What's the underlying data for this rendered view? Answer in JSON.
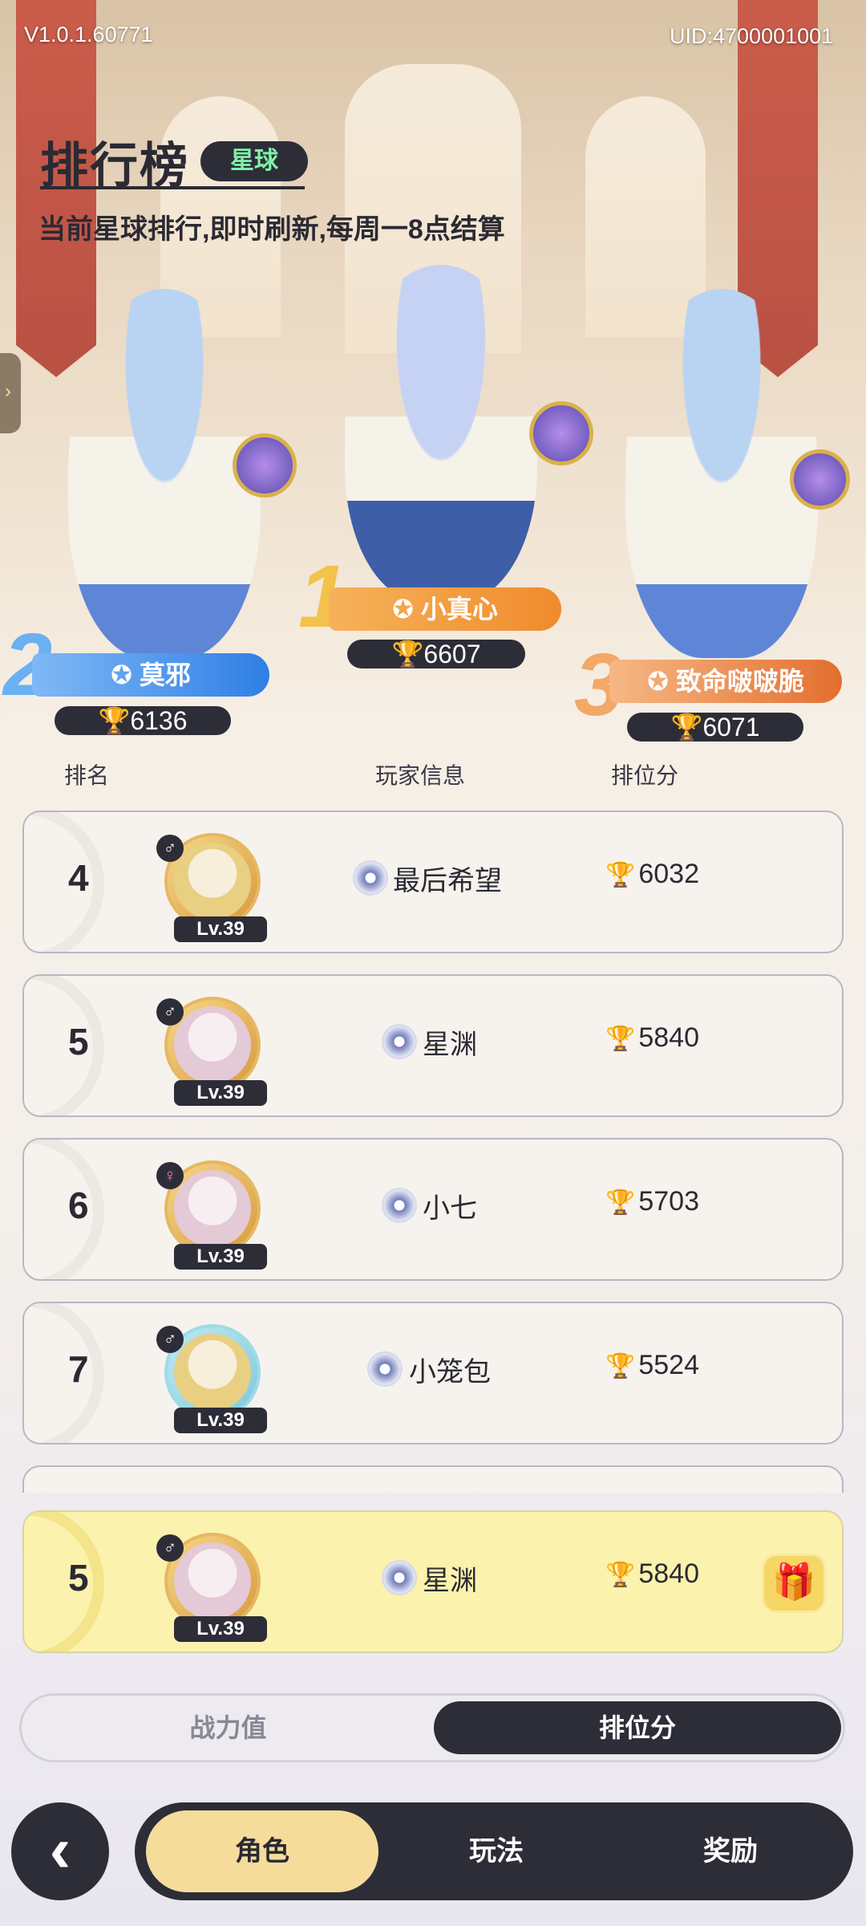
{
  "version": "V1.0.1.60771",
  "uid": "UID:4700001001",
  "header": {
    "title": "排行榜",
    "tag": "星球",
    "subtitle": "当前星球排行,即时刷新,每周一8点结算"
  },
  "podium": {
    "first": {
      "rank": "1",
      "name": "小真心",
      "score": "6607"
    },
    "second": {
      "rank": "2",
      "name": "莫邪",
      "score": "6136"
    },
    "third": {
      "rank": "3",
      "name": "致命啵啵脆",
      "score": "6071"
    }
  },
  "columns": {
    "rank": "排名",
    "player": "玩家信息",
    "score": "排位分"
  },
  "rows": [
    {
      "rank": "4",
      "name": "最后希望",
      "level": "Lv.39",
      "gender": "♂",
      "score": "6032"
    },
    {
      "rank": "5",
      "name": "星渊",
      "level": "Lv.39",
      "gender": "♂",
      "score": "5840"
    },
    {
      "rank": "6",
      "name": "小七",
      "level": "Lv.39",
      "gender": "♀",
      "score": "5703"
    },
    {
      "rank": "7",
      "name": "小笼包",
      "level": "Lv.39",
      "gender": "♂",
      "score": "5524"
    }
  ],
  "my_row": {
    "rank": "5",
    "name": "星渊",
    "level": "Lv.39",
    "gender": "♂",
    "score": "5840"
  },
  "tabs": {
    "power": "战力值",
    "rank_score": "排位分"
  },
  "nav": {
    "back": "‹",
    "role": "角色",
    "play": "玩法",
    "reward": "奖励"
  },
  "colors": {
    "dark": "#2d2d38",
    "accent_yellow": "#fbf2ad",
    "tag_green": "#7ff0a8",
    "first_orange": "#f39a3a",
    "second_blue": "#3f8ee8",
    "third_orange": "#e7833a"
  }
}
